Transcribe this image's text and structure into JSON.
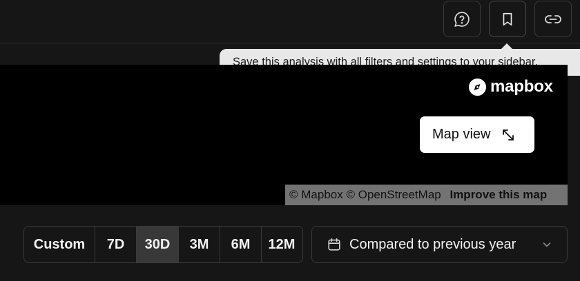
{
  "toolbar": {
    "help_icon": "help-chat-icon",
    "bookmark_icon": "bookmark-icon",
    "link_icon": "link-icon"
  },
  "tooltip": {
    "text": "Save this analysis with all filters and settings to your sidebar."
  },
  "map": {
    "logo_text": "mapbox",
    "map_view_label": "Map view",
    "expand_icon": "expand-arrows-icon",
    "attribution": {
      "mapbox": "© Mapbox",
      "osm": "© OpenStreetMap",
      "improve": "Improve this map"
    }
  },
  "range": {
    "options": [
      "Custom",
      "7D",
      "30D",
      "3M",
      "6M",
      "12M"
    ],
    "selected": "30D"
  },
  "compare": {
    "label": "Compared to previous year",
    "calendar_icon": "calendar-icon",
    "chevron_icon": "chevron-down-icon"
  },
  "colors": {
    "background": "#161616",
    "border": "#3a3a3a",
    "selected_segment": "#383838",
    "tooltip_bg": "#e8e8e8"
  }
}
